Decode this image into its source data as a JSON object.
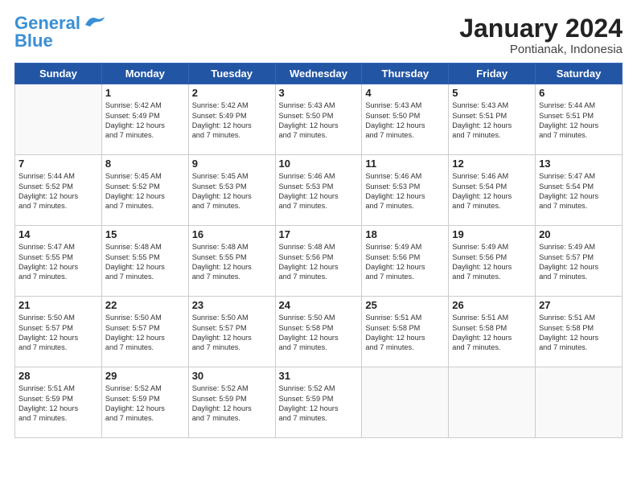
{
  "logo": {
    "line1": "General",
    "line2": "Blue"
  },
  "title": "January 2024",
  "subtitle": "Pontianak, Indonesia",
  "headers": [
    "Sunday",
    "Monday",
    "Tuesday",
    "Wednesday",
    "Thursday",
    "Friday",
    "Saturday"
  ],
  "weeks": [
    [
      {
        "day": "",
        "empty": true
      },
      {
        "day": "1",
        "sunrise": "5:42 AM",
        "sunset": "5:49 PM",
        "daylight": "12 hours and 7 minutes."
      },
      {
        "day": "2",
        "sunrise": "5:42 AM",
        "sunset": "5:49 PM",
        "daylight": "12 hours and 7 minutes."
      },
      {
        "day": "3",
        "sunrise": "5:43 AM",
        "sunset": "5:50 PM",
        "daylight": "12 hours and 7 minutes."
      },
      {
        "day": "4",
        "sunrise": "5:43 AM",
        "sunset": "5:50 PM",
        "daylight": "12 hours and 7 minutes."
      },
      {
        "day": "5",
        "sunrise": "5:43 AM",
        "sunset": "5:51 PM",
        "daylight": "12 hours and 7 minutes."
      },
      {
        "day": "6",
        "sunrise": "5:44 AM",
        "sunset": "5:51 PM",
        "daylight": "12 hours and 7 minutes."
      }
    ],
    [
      {
        "day": "7",
        "sunrise": "5:44 AM",
        "sunset": "5:52 PM",
        "daylight": "12 hours and 7 minutes."
      },
      {
        "day": "8",
        "sunrise": "5:45 AM",
        "sunset": "5:52 PM",
        "daylight": "12 hours and 7 minutes."
      },
      {
        "day": "9",
        "sunrise": "5:45 AM",
        "sunset": "5:53 PM",
        "daylight": "12 hours and 7 minutes."
      },
      {
        "day": "10",
        "sunrise": "5:46 AM",
        "sunset": "5:53 PM",
        "daylight": "12 hours and 7 minutes."
      },
      {
        "day": "11",
        "sunrise": "5:46 AM",
        "sunset": "5:53 PM",
        "daylight": "12 hours and 7 minutes."
      },
      {
        "day": "12",
        "sunrise": "5:46 AM",
        "sunset": "5:54 PM",
        "daylight": "12 hours and 7 minutes."
      },
      {
        "day": "13",
        "sunrise": "5:47 AM",
        "sunset": "5:54 PM",
        "daylight": "12 hours and 7 minutes."
      }
    ],
    [
      {
        "day": "14",
        "sunrise": "5:47 AM",
        "sunset": "5:55 PM",
        "daylight": "12 hours and 7 minutes."
      },
      {
        "day": "15",
        "sunrise": "5:48 AM",
        "sunset": "5:55 PM",
        "daylight": "12 hours and 7 minutes."
      },
      {
        "day": "16",
        "sunrise": "5:48 AM",
        "sunset": "5:55 PM",
        "daylight": "12 hours and 7 minutes."
      },
      {
        "day": "17",
        "sunrise": "5:48 AM",
        "sunset": "5:56 PM",
        "daylight": "12 hours and 7 minutes."
      },
      {
        "day": "18",
        "sunrise": "5:49 AM",
        "sunset": "5:56 PM",
        "daylight": "12 hours and 7 minutes."
      },
      {
        "day": "19",
        "sunrise": "5:49 AM",
        "sunset": "5:56 PM",
        "daylight": "12 hours and 7 minutes."
      },
      {
        "day": "20",
        "sunrise": "5:49 AM",
        "sunset": "5:57 PM",
        "daylight": "12 hours and 7 minutes."
      }
    ],
    [
      {
        "day": "21",
        "sunrise": "5:50 AM",
        "sunset": "5:57 PM",
        "daylight": "12 hours and 7 minutes."
      },
      {
        "day": "22",
        "sunrise": "5:50 AM",
        "sunset": "5:57 PM",
        "daylight": "12 hours and 7 minutes."
      },
      {
        "day": "23",
        "sunrise": "5:50 AM",
        "sunset": "5:57 PM",
        "daylight": "12 hours and 7 minutes."
      },
      {
        "day": "24",
        "sunrise": "5:50 AM",
        "sunset": "5:58 PM",
        "daylight": "12 hours and 7 minutes."
      },
      {
        "day": "25",
        "sunrise": "5:51 AM",
        "sunset": "5:58 PM",
        "daylight": "12 hours and 7 minutes."
      },
      {
        "day": "26",
        "sunrise": "5:51 AM",
        "sunset": "5:58 PM",
        "daylight": "12 hours and 7 minutes."
      },
      {
        "day": "27",
        "sunrise": "5:51 AM",
        "sunset": "5:58 PM",
        "daylight": "12 hours and 7 minutes."
      }
    ],
    [
      {
        "day": "28",
        "sunrise": "5:51 AM",
        "sunset": "5:59 PM",
        "daylight": "12 hours and 7 minutes."
      },
      {
        "day": "29",
        "sunrise": "5:52 AM",
        "sunset": "5:59 PM",
        "daylight": "12 hours and 7 minutes."
      },
      {
        "day": "30",
        "sunrise": "5:52 AM",
        "sunset": "5:59 PM",
        "daylight": "12 hours and 7 minutes."
      },
      {
        "day": "31",
        "sunrise": "5:52 AM",
        "sunset": "5:59 PM",
        "daylight": "12 hours and 7 minutes."
      },
      {
        "day": "",
        "empty": true
      },
      {
        "day": "",
        "empty": true
      },
      {
        "day": "",
        "empty": true
      }
    ]
  ],
  "labels": {
    "sunrise_prefix": "Sunrise: ",
    "sunset_prefix": "Sunset: ",
    "daylight_prefix": "Daylight: "
  }
}
